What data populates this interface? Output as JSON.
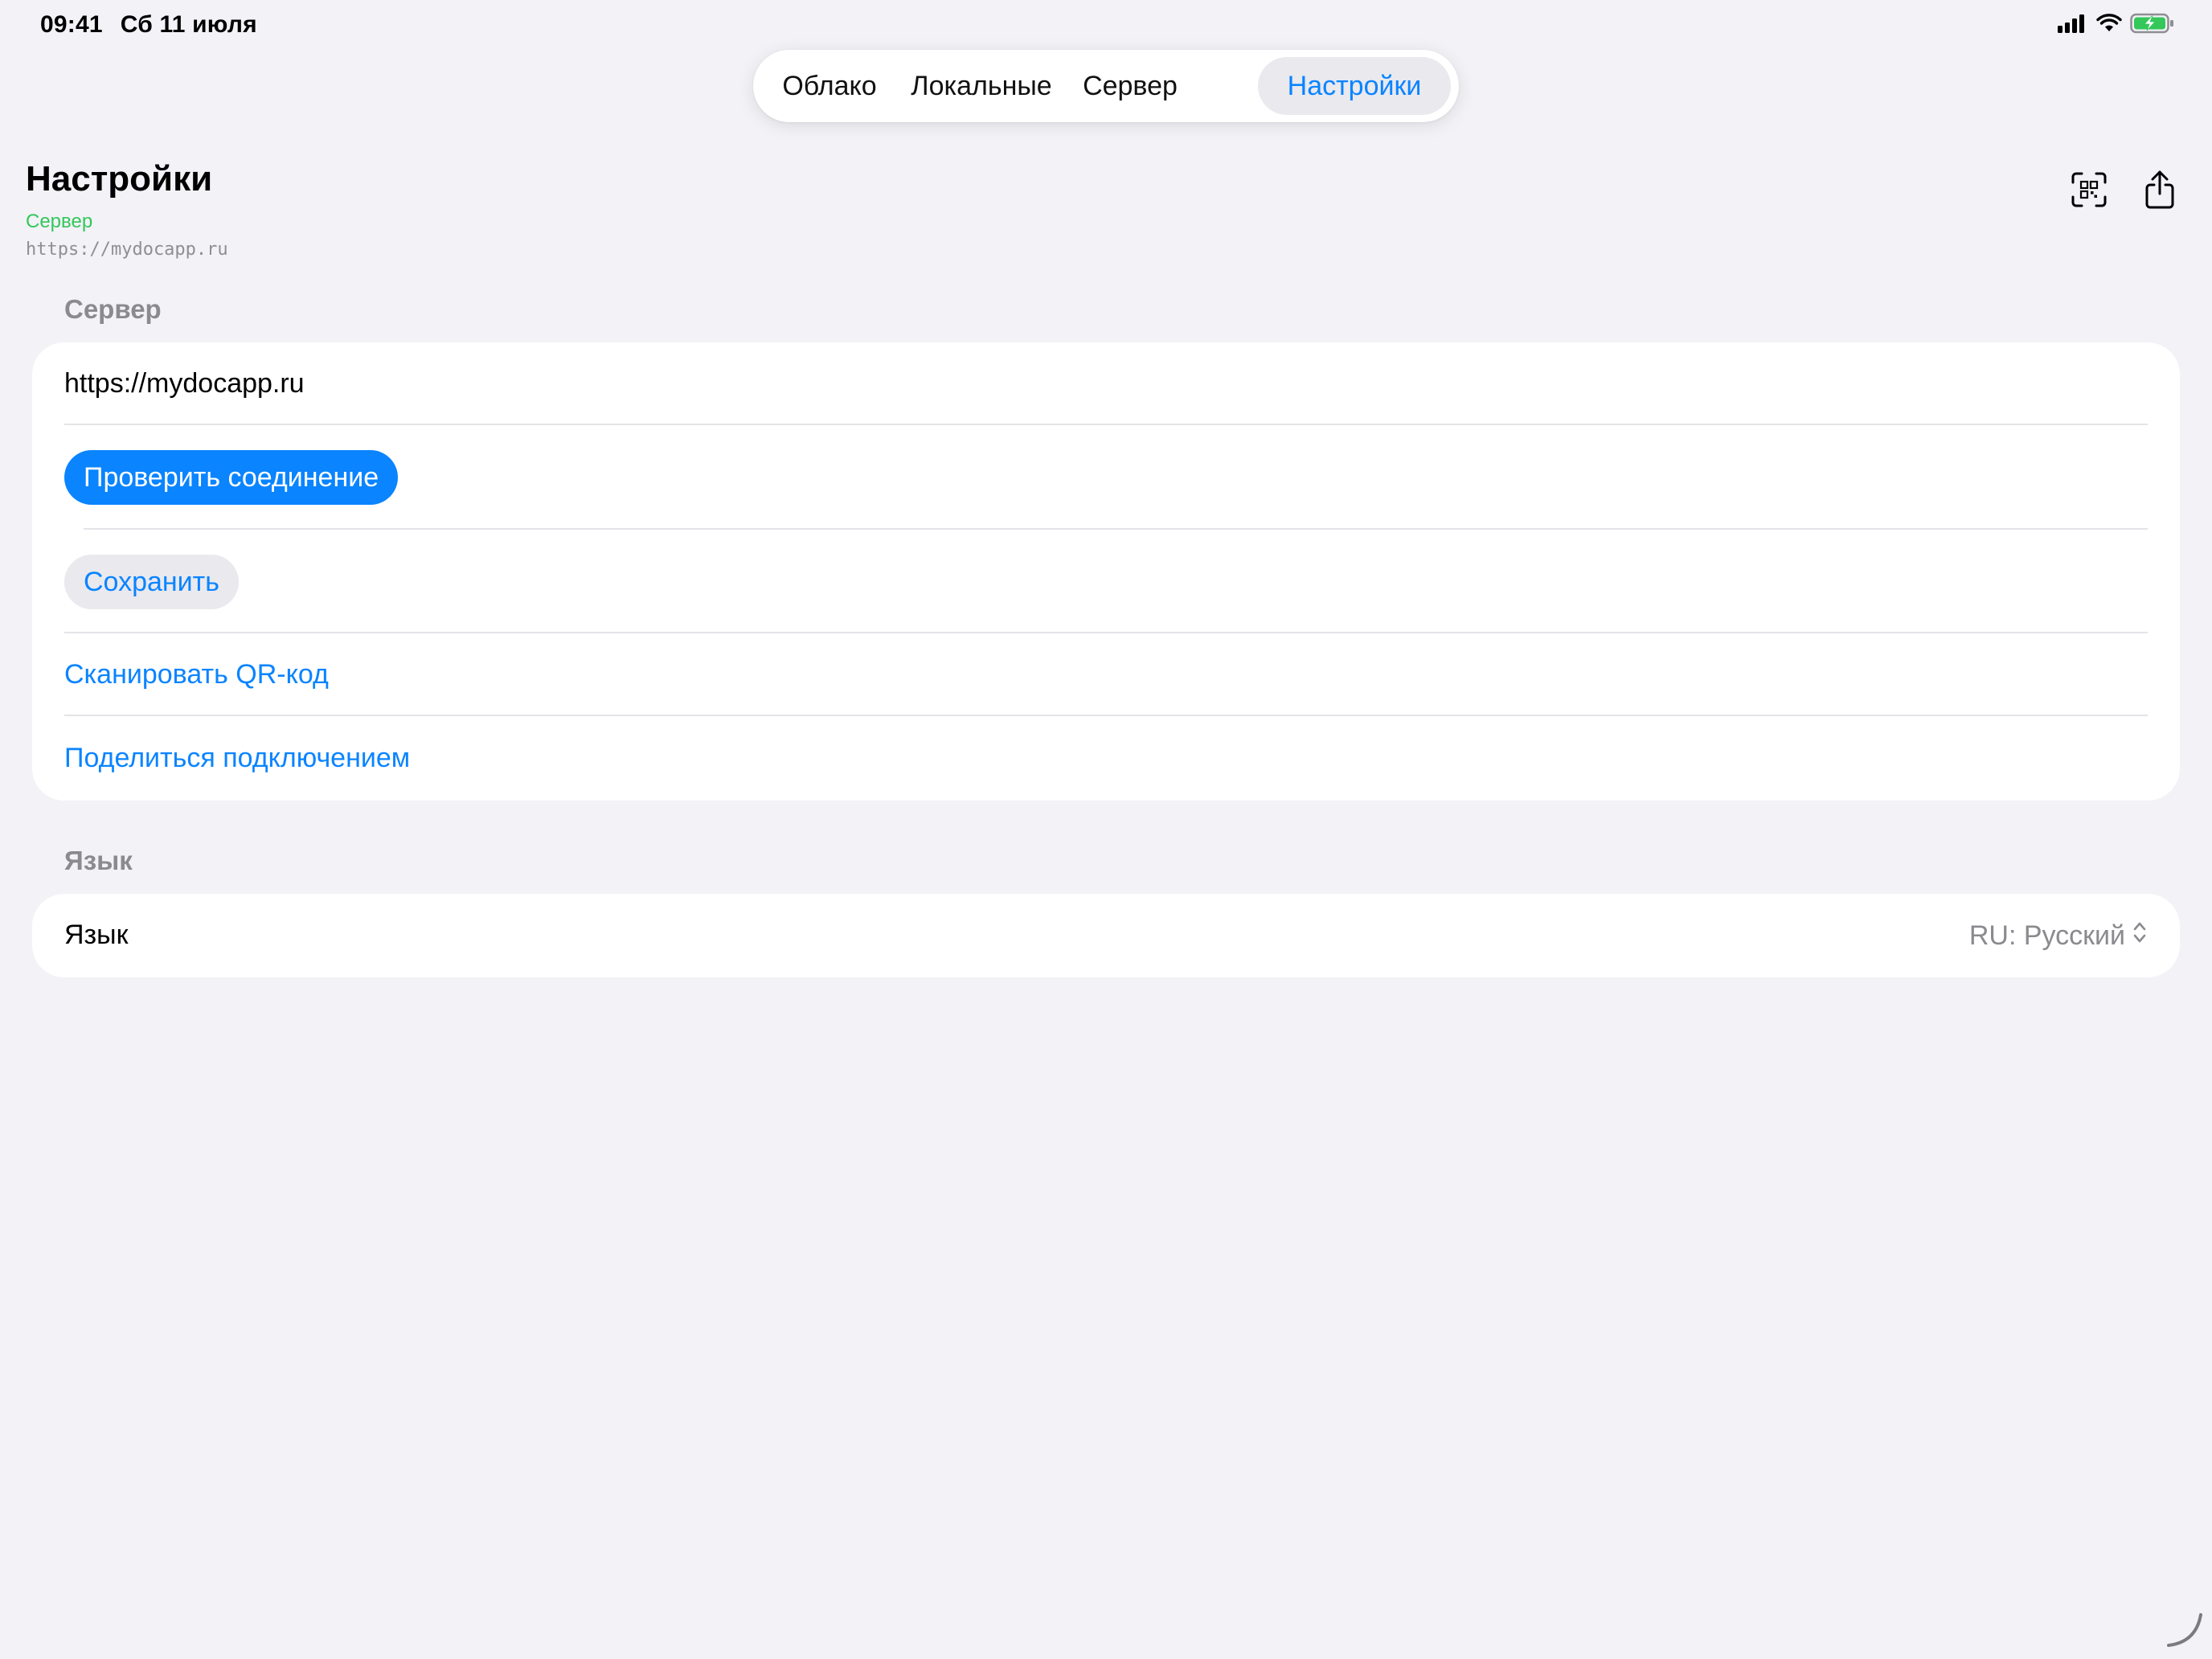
{
  "status_bar": {
    "time": "09:41",
    "date": "Сб 11 июля"
  },
  "tabs": [
    {
      "label": "Облако",
      "active": false
    },
    {
      "label": "Локальные",
      "active": false
    },
    {
      "label": "Сервер",
      "active": false
    },
    {
      "label": "Настройки",
      "active": true
    }
  ],
  "header": {
    "title": "Настройки",
    "subtitle": "Сервер",
    "url": "https://mydocapp.ru",
    "icons": [
      "qr-scan-icon",
      "share-icon"
    ]
  },
  "server_section": {
    "label": "Сервер",
    "url_value": "https://mydocapp.ru",
    "check_button": "Проверить соединение",
    "save_button": "Сохранить",
    "scan_qr_link": "Сканировать QR-код",
    "share_link": "Поделиться подключением"
  },
  "language_section": {
    "label": "Язык",
    "row_label": "Язык",
    "selected_value": "RU: Русский"
  },
  "colors": {
    "accent": "#0a84ff",
    "status_green": "#34c759",
    "background": "#f2f2f7"
  }
}
